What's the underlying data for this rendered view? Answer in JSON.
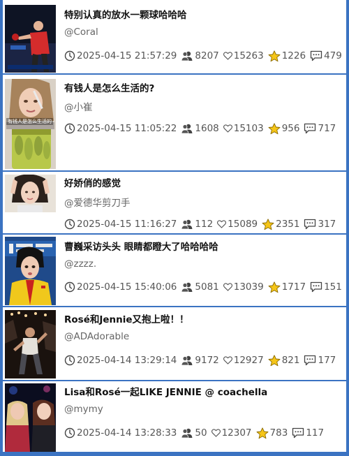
{
  "feed": [
    {
      "title": "特别认真的放水一颗球哈哈哈",
      "author": "@Coral",
      "time": "2025-04-15 21:57:29",
      "fans": "8207",
      "likes": "15263",
      "stars": "1226",
      "comments": "479"
    },
    {
      "title": "有钱人是怎么生活的?",
      "author": "@小崔",
      "time": "2025-04-15 11:05:22",
      "fans": "1608",
      "likes": "15103",
      "stars": "956",
      "comments": "717",
      "thumb_caption": "有钱人是怎么生活的"
    },
    {
      "title": "好娇俏的感觉",
      "author": "@爱德华剪刀手",
      "time": "2025-04-15 11:16:27",
      "fans": "112",
      "likes": "15089",
      "stars": "2351",
      "comments": "317"
    },
    {
      "title": "曹巍采访头头 眼睛都瞪大了哈哈哈哈",
      "author": "@zzzz.",
      "time": "2025-04-15 15:40:06",
      "fans": "5081",
      "likes": "13039",
      "stars": "1717",
      "comments": "151"
    },
    {
      "title": "Rosé和Jennie又抱上啦！！",
      "author": "@ADAdorable",
      "time": "2025-04-14 13:29:14",
      "fans": "9172",
      "likes": "12927",
      "stars": "821",
      "comments": "177"
    },
    {
      "title": "Lisa和Rosé一起LIKE JENNIE @ coachella",
      "author": "@mymy",
      "time": "2025-04-14 13:28:33",
      "fans": "50",
      "likes": "12307",
      "stars": "783",
      "comments": "117"
    }
  ],
  "icons": {
    "time": "clock-icon",
    "fans": "people-icon",
    "likes": "heart-icon",
    "stars": "star-icon",
    "comments": "comment-icon"
  },
  "colors": {
    "frame": "#3b73c2",
    "star": "#f5c518",
    "heart": "#555555"
  }
}
